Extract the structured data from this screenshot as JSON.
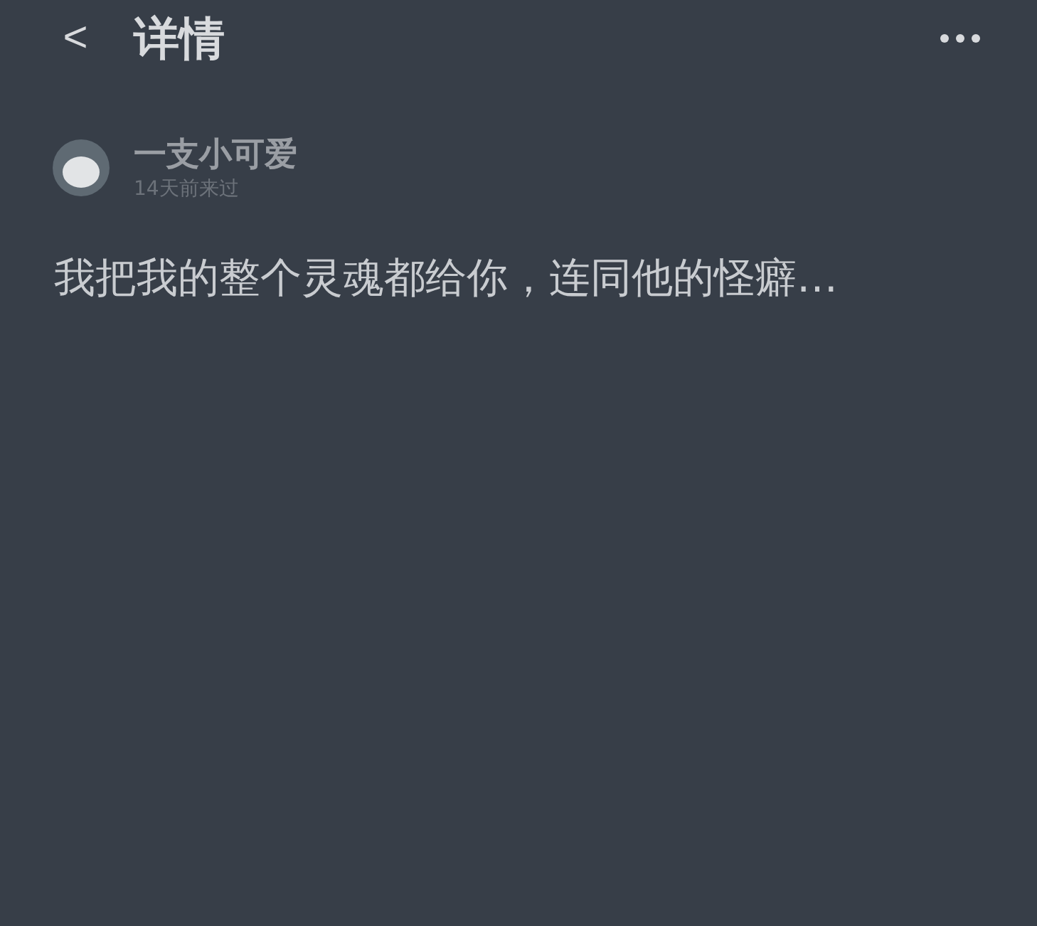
{
  "header": {
    "back": "<",
    "title": "详情"
  },
  "post": {
    "author": "一支小可爱",
    "last_seen": "14天前来过",
    "content": "我把我的整个灵魂都给你，连同他的怪癖…"
  }
}
